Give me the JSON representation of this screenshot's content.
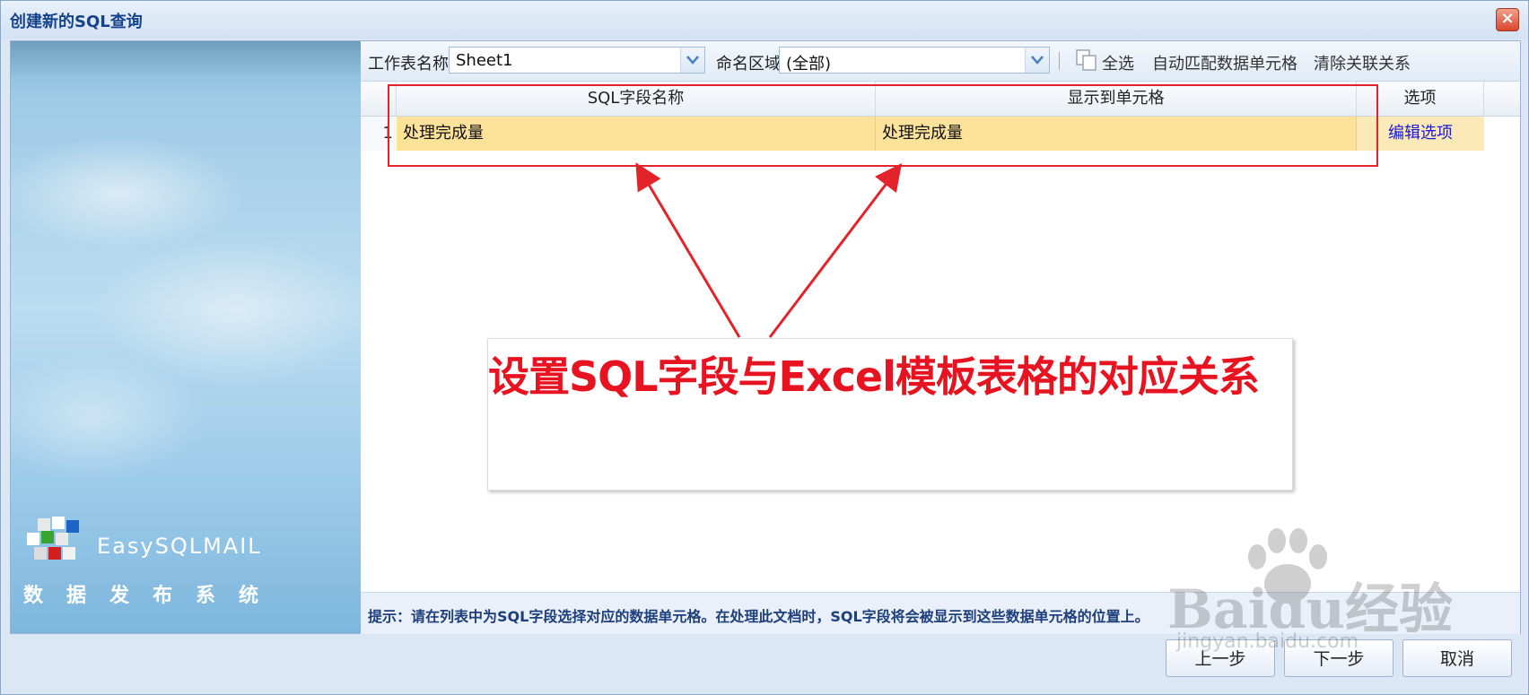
{
  "window": {
    "title": "创建新的SQL查询",
    "close_label": "×"
  },
  "banner": {
    "brand": "EasySQLMAIL",
    "slogan": "数据发布系统"
  },
  "toolbar": {
    "sheet_label": "工作表名称",
    "sheet_value": "Sheet1",
    "range_label": "命名区域",
    "range_value": "(全部)",
    "select_all": "全选",
    "auto_match": "自动匹配数据单元格",
    "clear_links": "清除关联关系"
  },
  "grid": {
    "columns": [
      "SQL字段名称",
      "显示到单元格",
      "选项"
    ],
    "rows": [
      {
        "num": "1",
        "sql_field": "处理完成量",
        "cell": "处理完成量",
        "option": "编辑选项"
      }
    ]
  },
  "annotation": {
    "text": "设置SQL字段与Excel模板表格的对应关系",
    "color": "#e81320"
  },
  "hint": "提示：请在列表中为SQL字段选择对应的数据单元格。在处理此文档时，SQL字段将会被显示到这些数据单元格的位置上。",
  "buttons": {
    "prev": "上一步",
    "next": "下一步",
    "cancel": "取消"
  },
  "watermark": {
    "main": "Baidu经验",
    "sub": "jingyan.baidu.com"
  }
}
